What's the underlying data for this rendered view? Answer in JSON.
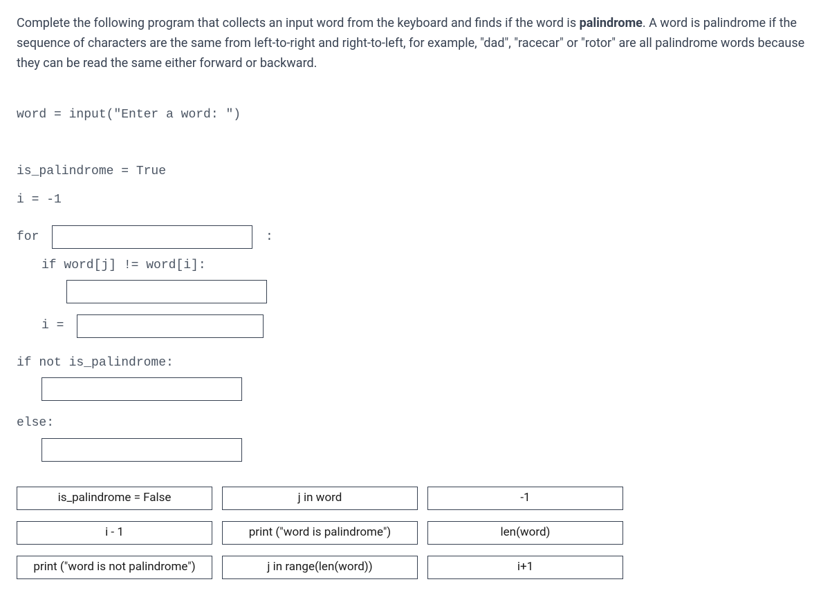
{
  "instructions_pre": "Complete the following program that collects an input word from the keyboard and finds if the word is ",
  "instructions_bold": "palindrome",
  "instructions_post": ". A word is palindrome if the sequence of characters are the same from left-to-right and right-to-left, for example, \"dad\", \"racecar\" or \"rotor\" are all palindrome words because they can be read the same either forward or backward.",
  "code": {
    "line1": "word = input(\"Enter a word: \")",
    "line2": "is_palindrome = True",
    "line3": "i = -1",
    "for_kw": "for ",
    "for_colon": " :",
    "if_cond": "if word[j] != word[i]:",
    "i_eq": "i = ",
    "if_not": "if not is_palindrome:",
    "else_kw": "else:"
  },
  "options": {
    "row1": [
      "is_palindrome = False",
      "j in word",
      "-1"
    ],
    "row2": [
      "i - 1",
      "print (\"word is palindrome\")",
      "len(word)"
    ],
    "row3": [
      "print (\"word is not palindrome\")",
      "j in range(len(word))",
      "i+1"
    ]
  }
}
